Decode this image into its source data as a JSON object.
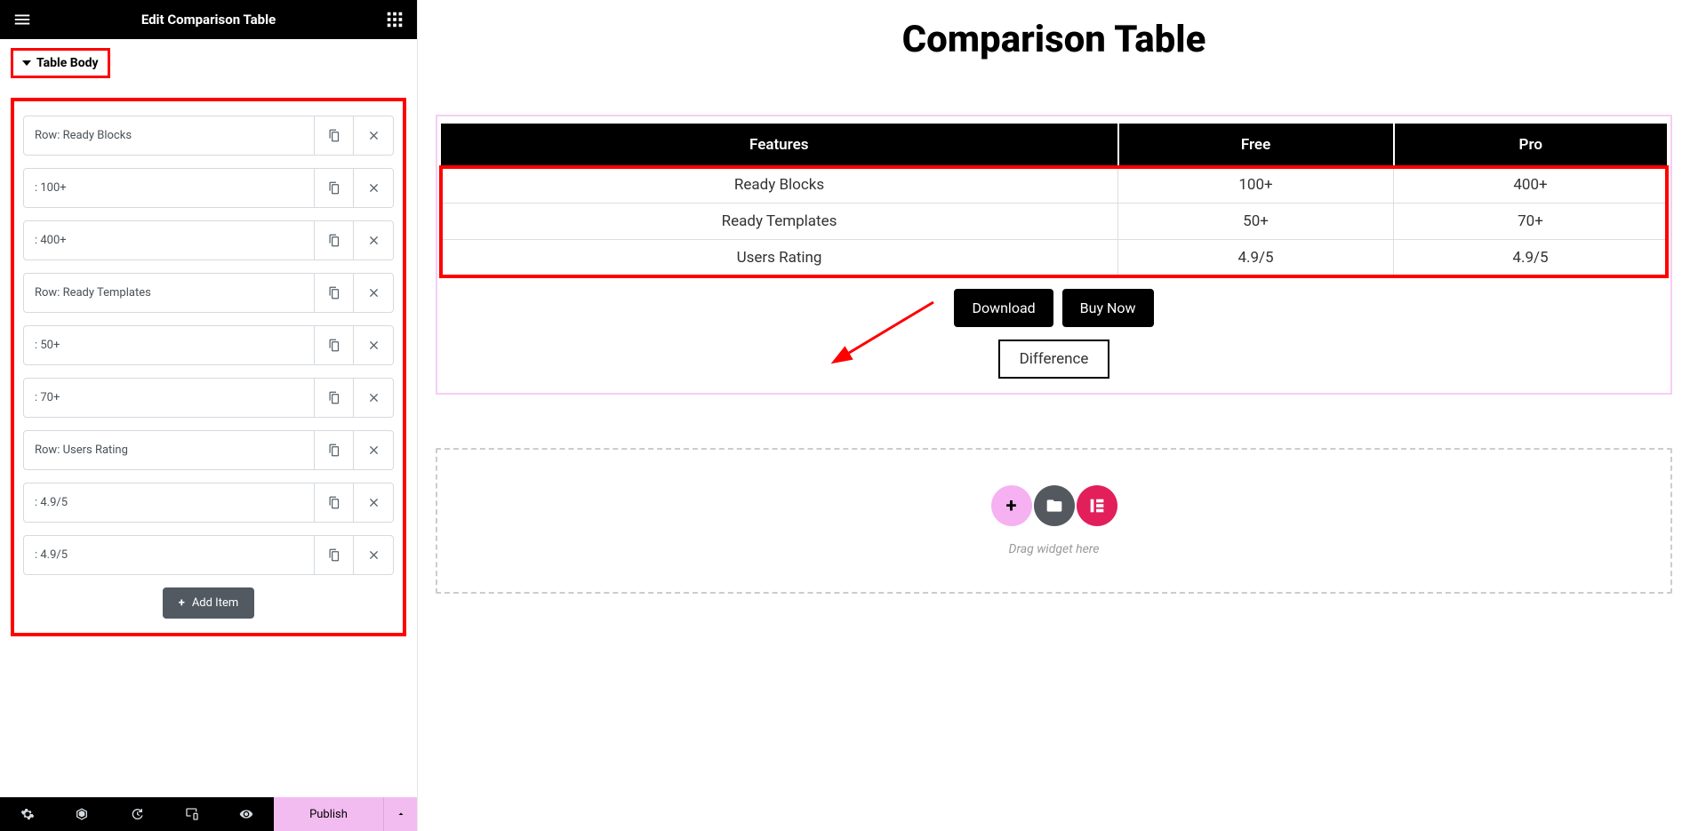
{
  "panel": {
    "title": "Edit Comparison Table",
    "section_name": "Table Body",
    "add_item_label": "Add Item",
    "publish_label": "Publish",
    "items": [
      {
        "label": "Row: Ready Blocks"
      },
      {
        "label": ": 100+"
      },
      {
        "label": ": 400+"
      },
      {
        "label": "Row: Ready Templates"
      },
      {
        "label": ": 50+"
      },
      {
        "label": ": 70+"
      },
      {
        "label": "Row: Users Rating"
      },
      {
        "label": ": 4.9/5"
      },
      {
        "label": ": 4.9/5"
      }
    ]
  },
  "preview": {
    "heading": "Comparison Table",
    "columns": [
      "Features",
      "Free",
      "Pro"
    ],
    "rows": [
      [
        "Ready Blocks",
        "100+",
        "400+"
      ],
      [
        "Ready Templates",
        "50+",
        "70+"
      ],
      [
        "Users Rating",
        "4.9/5",
        "4.9/5"
      ]
    ],
    "download_label": "Download",
    "buy_label": "Buy Now",
    "difference_label": "Difference",
    "drop_hint": "Drag widget here"
  }
}
